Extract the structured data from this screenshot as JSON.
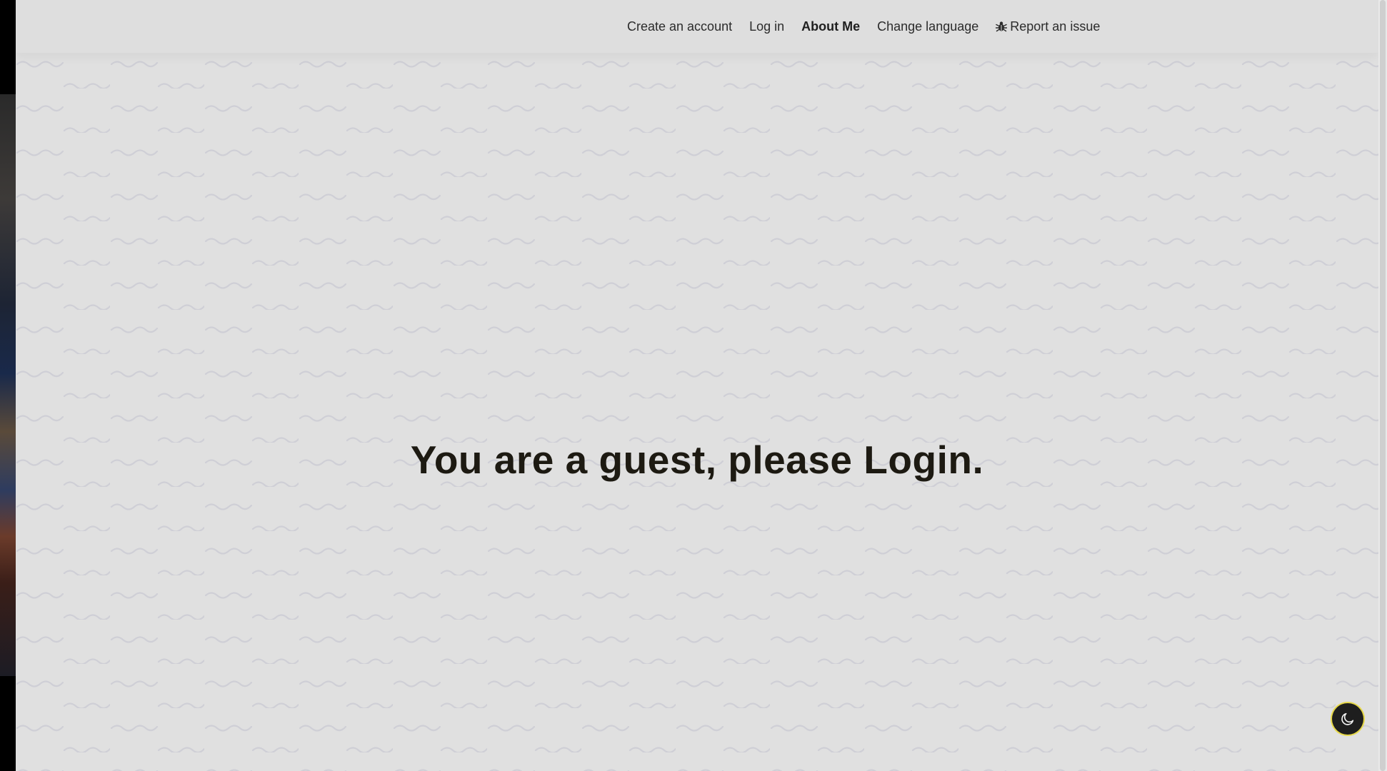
{
  "nav": {
    "items": [
      {
        "label": "Create an account"
      },
      {
        "label": "Log in"
      },
      {
        "label": "About Me"
      },
      {
        "label": "Change language"
      },
      {
        "label": "Report an issue",
        "icon": "bug-icon"
      }
    ],
    "active_item": "About Me"
  },
  "main": {
    "headline": "You are a guest, please Login."
  },
  "theme_toggle": {
    "icon": "moon-icon"
  },
  "colors": {
    "background": "#e0e0e0",
    "navbar": "#dedede",
    "headline": "#1d1a12",
    "toggle": "#1e1e1e",
    "toggle_ring": "#e6d84a"
  }
}
